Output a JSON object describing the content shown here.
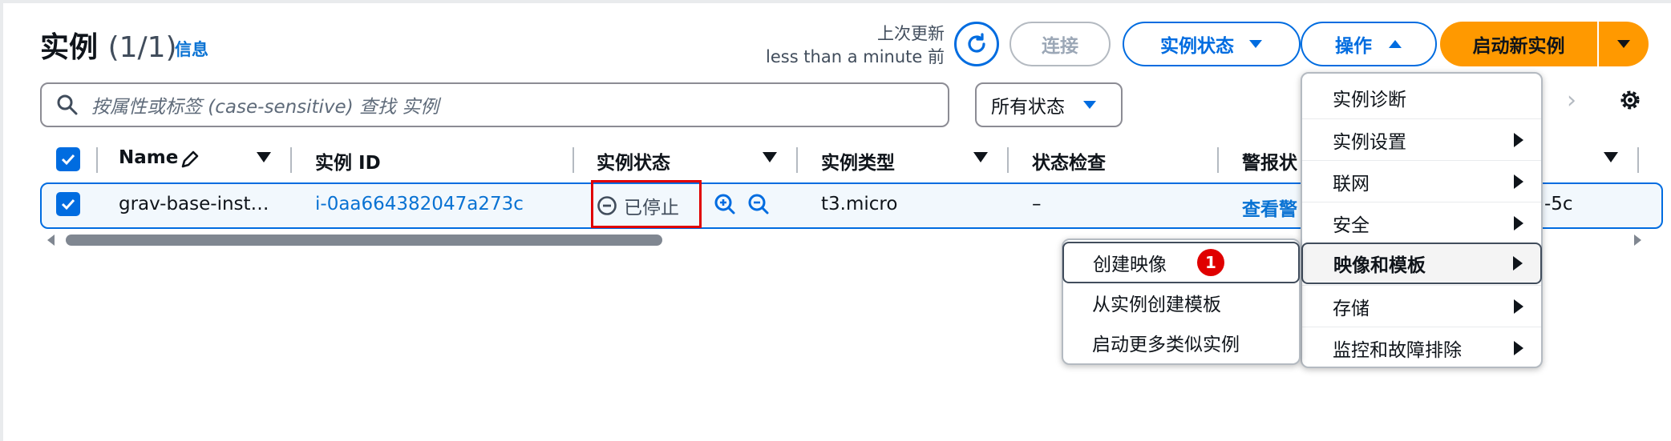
{
  "header": {
    "title": "实例",
    "count": "(1/1)",
    "info_link": "信息",
    "last_updated_label": "上次更新",
    "last_updated_value": "less than a minute 前"
  },
  "toolbar": {
    "connect_label": "连接",
    "instance_state_label": "实例状态",
    "actions_label": "操作",
    "launch_label": "启动新实例"
  },
  "search": {
    "placeholder": "按属性或标签 (case-sensitive) 查找 实例",
    "status_filter": "所有状态"
  },
  "table": {
    "columns": [
      "Name",
      "实例 ID",
      "实例状态",
      "实例类型",
      "状态检查",
      "警报状"
    ],
    "rows": [
      {
        "name": "grav-base-inst…",
        "instance_id": "i-0aa664382047a273c",
        "state": "已停止",
        "type": "t3.micro",
        "status_check": "–",
        "alarm": "查看警",
        "az_tail": "-5c"
      }
    ]
  },
  "actions_menu": {
    "items": [
      {
        "label": "实例诊断",
        "has_submenu": false
      },
      {
        "label": "实例设置",
        "has_submenu": true
      },
      {
        "label": "联网",
        "has_submenu": true
      },
      {
        "label": "安全",
        "has_submenu": true
      },
      {
        "label": "映像和模板",
        "has_submenu": true,
        "active": true
      },
      {
        "label": "存储",
        "has_submenu": true
      },
      {
        "label": "监控和故障排除",
        "has_submenu": true
      }
    ]
  },
  "submenu": {
    "items": [
      {
        "label": "创建映像",
        "badge": "1"
      },
      {
        "label": "从实例创建模板"
      },
      {
        "label": "启动更多类似实例"
      }
    ]
  },
  "colors": {
    "primary": "#006ce0",
    "link": "#0972d3",
    "launch": "#ff9900",
    "highlight": "#e00000"
  }
}
